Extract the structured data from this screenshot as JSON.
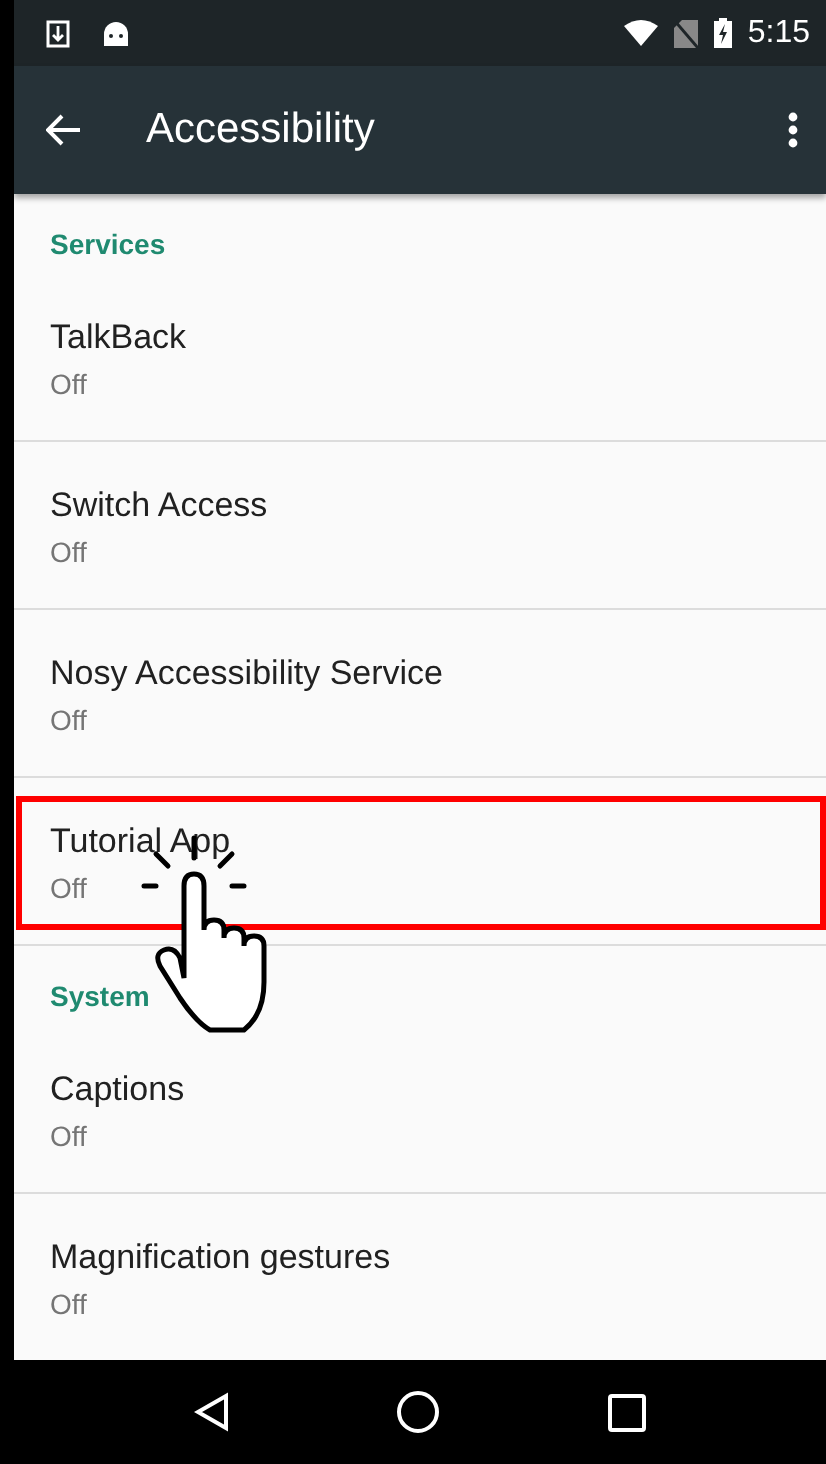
{
  "status_bar": {
    "time": "5:15"
  },
  "toolbar": {
    "title": "Accessibility"
  },
  "sections": [
    {
      "header": "Services",
      "items": [
        {
          "title": "TalkBack",
          "summary": "Off",
          "highlighted": false
        },
        {
          "title": "Switch Access",
          "summary": "Off",
          "highlighted": false
        },
        {
          "title": "Nosy Accessibility Service",
          "summary": "Off",
          "highlighted": false
        },
        {
          "title": "Tutorial App",
          "summary": "Off",
          "highlighted": true
        }
      ]
    },
    {
      "header": "System",
      "items": [
        {
          "title": "Captions",
          "summary": "Off",
          "highlighted": false
        },
        {
          "title": "Magnification gestures",
          "summary": "Off",
          "highlighted": false
        }
      ]
    }
  ]
}
